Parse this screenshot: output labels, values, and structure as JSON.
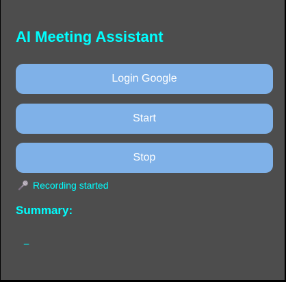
{
  "app": {
    "title": "AI Meeting Assistant"
  },
  "buttons": {
    "login_label": "Login Google",
    "start_label": "Start",
    "stop_label": "Stop"
  },
  "status": {
    "icon": "microphone-icon",
    "text": "Recording started"
  },
  "summary": {
    "heading": "Summary:",
    "content": "_"
  },
  "colors": {
    "background": "#4d4d4d",
    "accent": "#00ffff",
    "button": "#7fb1e8",
    "button_text": "#ffffff"
  }
}
